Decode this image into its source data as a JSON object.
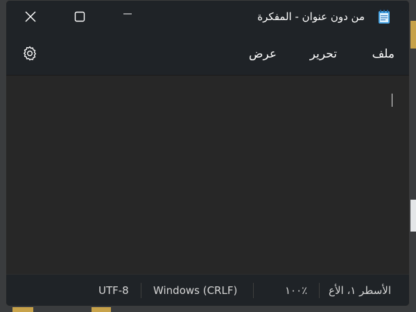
{
  "window": {
    "title": "من دون عنوان - المفكرة",
    "app_icon": "notepad-icon",
    "controls": {
      "minimize_icon": "minimize-icon",
      "maximize_icon": "maximize-icon",
      "close_icon": "close-icon"
    }
  },
  "menu": {
    "file_label": "ملف",
    "edit_label": "تحرير",
    "view_label": "عرض",
    "settings_icon": "gear-icon"
  },
  "editor": {
    "content": ""
  },
  "status": {
    "position": "الأسطر ١، الأع",
    "zoom": "١٠٠٪",
    "line_ending": "Windows (CRLF)",
    "encoding": "UTF-8"
  },
  "colors": {
    "titlebar": "#1f2327",
    "editor_bg": "#272727",
    "text": "#ffffff",
    "status_text": "#d6d6d6"
  }
}
